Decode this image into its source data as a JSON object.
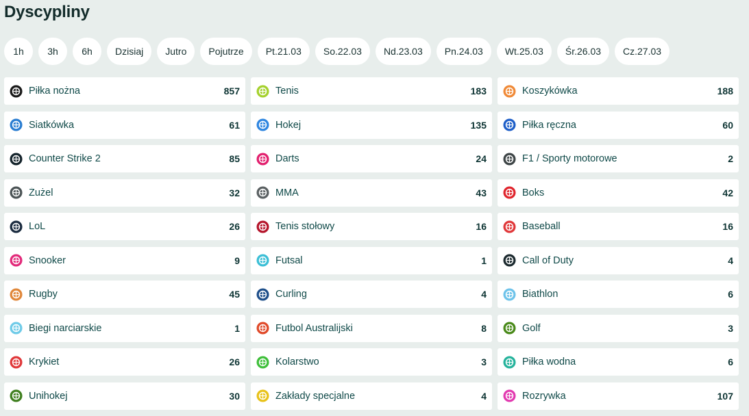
{
  "page_title": "Dyscypliny",
  "filters": [
    "1h",
    "3h",
    "6h",
    "Dzisiaj",
    "Jutro",
    "Pojutrze",
    "Pt.21.03",
    "So.22.03",
    "Nd.23.03",
    "Pn.24.03",
    "Wt.25.03",
    "Śr.26.03",
    "Cz.27.03"
  ],
  "sports": [
    {
      "name": "Piłka nożna",
      "count": "857",
      "icon": "soccer-ball-icon",
      "color": "#1a1a1a"
    },
    {
      "name": "Tenis",
      "count": "183",
      "icon": "tennis-ball-icon",
      "color": "#a5d12e"
    },
    {
      "name": "Koszykówka",
      "count": "188",
      "icon": "basketball-icon",
      "color": "#f08a38"
    },
    {
      "name": "Siatkówka",
      "count": "61",
      "icon": "volleyball-icon",
      "color": "#2a7dd1"
    },
    {
      "name": "Hokej",
      "count": "135",
      "icon": "hockey-stick-icon",
      "color": "#2f86e0"
    },
    {
      "name": "Piłka ręczna",
      "count": "60",
      "icon": "handball-icon",
      "color": "#1f5fc8"
    },
    {
      "name": "Counter Strike 2",
      "count": "85",
      "icon": "counter-strike-icon",
      "color": "#14232b"
    },
    {
      "name": "Darts",
      "count": "24",
      "icon": "dart-icon",
      "color": "#e2206e"
    },
    {
      "name": "F1 / Sporty motorowe",
      "count": "2",
      "icon": "racing-helmet-icon",
      "color": "#3e4547"
    },
    {
      "name": "Żużel",
      "count": "32",
      "icon": "speedway-helmet-icon",
      "color": "#4c5456"
    },
    {
      "name": "MMA",
      "count": "43",
      "icon": "mma-glove-icon",
      "color": "#5b6163"
    },
    {
      "name": "Boks",
      "count": "42",
      "icon": "boxing-glove-icon",
      "color": "#e0262e"
    },
    {
      "name": "LoL",
      "count": "26",
      "icon": "league-of-legends-icon",
      "color": "#1a2b3f"
    },
    {
      "name": "Tenis stołowy",
      "count": "16",
      "icon": "ping-pong-paddle-icon",
      "color": "#b5152b"
    },
    {
      "name": "Baseball",
      "count": "16",
      "icon": "baseball-bat-icon",
      "color": "#e0383a"
    },
    {
      "name": "Snooker",
      "count": "9",
      "icon": "snooker-balls-icon",
      "color": "#e22a7a"
    },
    {
      "name": "Futsal",
      "count": "1",
      "icon": "futsal-ball-icon",
      "color": "#3cbfd6"
    },
    {
      "name": "Call of Duty",
      "count": "4",
      "icon": "call-of-duty-icon",
      "color": "#1c2a2f"
    },
    {
      "name": "Rugby",
      "count": "45",
      "icon": "rugby-ball-icon",
      "color": "#e0873a"
    },
    {
      "name": "Curling",
      "count": "4",
      "icon": "curling-stone-icon",
      "color": "#1e4f8a"
    },
    {
      "name": "Biathlon",
      "count": "6",
      "icon": "biathlon-icon",
      "color": "#6ec3ea"
    },
    {
      "name": "Biegi narciarskie",
      "count": "1",
      "icon": "cross-country-ski-icon",
      "color": "#6fcbe8"
    },
    {
      "name": "Futbol Australijski",
      "count": "8",
      "icon": "australian-football-icon",
      "color": "#e04a2a"
    },
    {
      "name": "Golf",
      "count": "3",
      "icon": "golf-icon",
      "color": "#4a8a1a"
    },
    {
      "name": "Krykiet",
      "count": "26",
      "icon": "cricket-bat-icon",
      "color": "#e0383a"
    },
    {
      "name": "Kolarstwo",
      "count": "3",
      "icon": "bicycle-icon",
      "color": "#3fbf3a"
    },
    {
      "name": "Piłka wodna",
      "count": "6",
      "icon": "water-polo-ball-icon",
      "color": "#26b39c"
    },
    {
      "name": "Unihokej",
      "count": "30",
      "icon": "floorball-icon",
      "color": "#3f7f1f"
    },
    {
      "name": "Zakłady specjalne",
      "count": "4",
      "icon": "trophy-icon",
      "color": "#e8c21a"
    },
    {
      "name": "Rozrywka",
      "count": "107",
      "icon": "entertainment-icon",
      "color": "#e23ab0"
    }
  ]
}
